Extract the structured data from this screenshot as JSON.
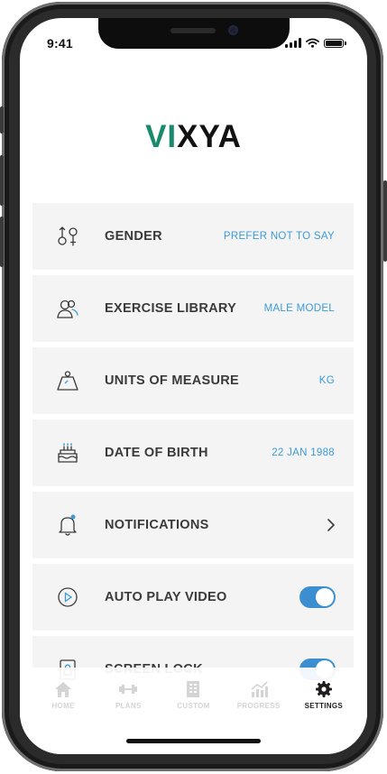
{
  "status_bar": {
    "time": "9:41"
  },
  "brand": {
    "logo_accent": "VI",
    "logo_rest": "XYA",
    "accent_color": "#1a8a6c"
  },
  "settings": [
    {
      "label": "GENDER",
      "value": "PREFER NOT TO SAY",
      "icon": "gender-icon"
    },
    {
      "label": "EXERCISE LIBRARY",
      "value": "MALE MODEL",
      "icon": "users-icon"
    },
    {
      "label": "UNITS OF MEASURE",
      "value": "KG",
      "icon": "weight-icon"
    },
    {
      "label": "DATE OF BIRTH",
      "value": "22 JAN 1988",
      "icon": "cake-icon"
    },
    {
      "label": "NOTIFICATIONS",
      "icon": "bell-icon",
      "control": "chevron"
    },
    {
      "label": "AUTO PLAY VIDEO",
      "icon": "play-icon",
      "control": "toggle",
      "toggle_on": true
    },
    {
      "label": "SCREEN LOCK",
      "icon": "lock-icon",
      "control": "toggle",
      "toggle_on": true
    }
  ],
  "tabbar": {
    "tabs": [
      {
        "label": "HOME",
        "icon": "home-icon"
      },
      {
        "label": "PLANS",
        "icon": "dumbbell-icon"
      },
      {
        "label": "CUSTOM",
        "icon": "building-icon"
      },
      {
        "label": "PROGRESS",
        "icon": "chart-icon"
      },
      {
        "label": "SETTINGS",
        "icon": "gear-icon"
      }
    ],
    "active": "SETTINGS"
  },
  "colors": {
    "accent": "#3b9bd9",
    "toggle": "#3b8fd1",
    "row_bg": "#f4f4f4"
  }
}
